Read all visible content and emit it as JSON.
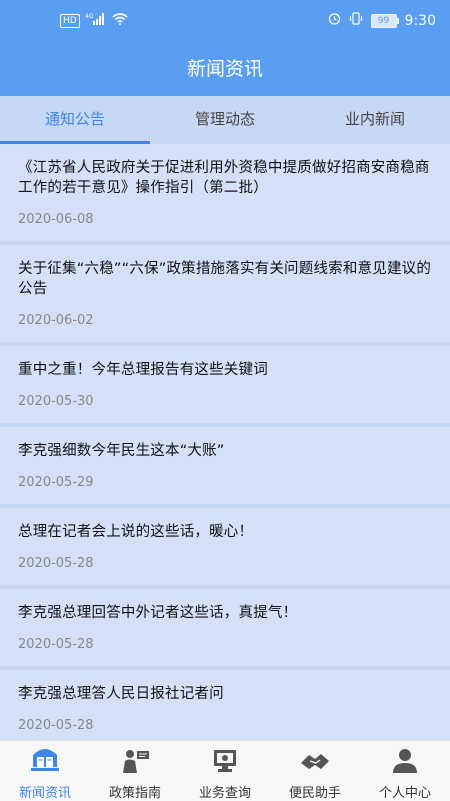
{
  "status": {
    "network_badge": "HD",
    "signal_label": "4G",
    "battery": "99",
    "time": "9:30"
  },
  "header": {
    "title": "新闻资讯"
  },
  "tabs": [
    {
      "label": "通知公告",
      "active": true
    },
    {
      "label": "管理动态",
      "active": false
    },
    {
      "label": "业内新闻",
      "active": false
    }
  ],
  "news": [
    {
      "title": "《江苏省人民政府关于促进利用外资稳中提质做好招商安商稳商工作的若干意见》操作指引（第二批）",
      "date": "2020-06-08"
    },
    {
      "title": "关于征集“六稳”“六保”政策措施落实有关问题线索和意见建议的公告",
      "date": "2020-06-02"
    },
    {
      "title": "重中之重！今年总理报告有这些关键词",
      "date": "2020-05-30"
    },
    {
      "title": "李克强细数今年民生这本“大账”",
      "date": "2020-05-29"
    },
    {
      "title": "总理在记者会上说的这些话，暖心！",
      "date": "2020-05-28"
    },
    {
      "title": "李克强总理回答中外记者这些话，真提气！",
      "date": "2020-05-28"
    },
    {
      "title": "李克强总理答人民日报社记者问",
      "date": "2020-05-28"
    }
  ],
  "bottom_nav": [
    {
      "label": "新闻资讯",
      "icon": "news-icon",
      "active": true
    },
    {
      "label": "政策指南",
      "icon": "policy-icon",
      "active": false
    },
    {
      "label": "业务查询",
      "icon": "business-query-icon",
      "active": false
    },
    {
      "label": "便民助手",
      "icon": "helper-icon",
      "active": false
    },
    {
      "label": "个人中心",
      "icon": "user-icon",
      "active": false
    }
  ],
  "colors": {
    "header_bg": "#5a9ef2",
    "accent": "#3a86ea",
    "list_bg": "#d3e0f7"
  }
}
